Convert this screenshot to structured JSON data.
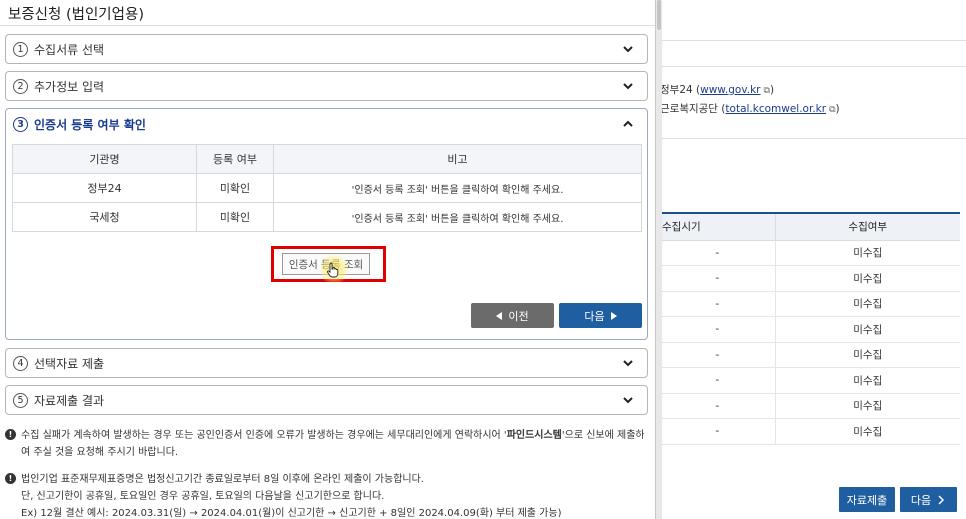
{
  "modal": {
    "title": "보증신청 (법인기업용)",
    "steps": [
      {
        "num": "1",
        "label": "수집서류 선택"
      },
      {
        "num": "2",
        "label": "추가정보 입력"
      },
      {
        "num": "3",
        "label": "인증서 등록 여부 확인"
      },
      {
        "num": "4",
        "label": "선택자료 제출"
      },
      {
        "num": "5",
        "label": "자료제출 결과"
      }
    ],
    "cert_table": {
      "headers": [
        "기관명",
        "등록 여부",
        "비고"
      ],
      "rows": [
        [
          "정부24",
          "미확인",
          "'인증서 등록 조회' 버튼을 클릭하여 확인해 주세요."
        ],
        [
          "국세청",
          "미확인",
          "'인증서 등록 조회' 버튼을 클릭하여 확인해 주세요."
        ]
      ]
    },
    "query_button": "인증서 등록 조회",
    "prev_button": "이전",
    "next_button": "다음",
    "notices": {
      "n1_pre": "수집 실패가 계속하여 발생하는 경우 또는 공인인증서 인증에 오류가 발생하는 경우에는 세무대리인에게 연락하시어 '",
      "n1_bold": "파인드시스템",
      "n1_post": "'으로 신보에 제출하여 주실 것을 요청해 주시기 바랍니다.",
      "n2_l1": "법인기업 표준재무제표증명은 법정신고기간 종료일로부터 8일 이후에 온라인 제출이 가능합니다.",
      "n2_l2": "단, 신고기한이 공휴일, 토요일인 경우 공휴일, 토요일의 다음날을 신고기한으로 합니다.",
      "n2_l3": "Ex) 12월 결산 예시: 2024.03.31(일) → 2024.04.01(월)이 신고기한 → 신고기한 + 8일인 2024.04.09(화) 부터 제출 가능)"
    }
  },
  "background": {
    "link1_prefix": "정부24 (",
    "link1_text": "www.gov.kr",
    "link1_suffix": ")",
    "link2_prefix": "근로복지공단 (",
    "link2_text": "total.kcomwel.or.kr",
    "link2_suffix": ")",
    "table_headers": [
      "수집시기",
      "수집여부"
    ],
    "table_rows": [
      [
        "-",
        "미수집"
      ],
      [
        "-",
        "미수집"
      ],
      [
        "-",
        "미수집"
      ],
      [
        "-",
        "미수집"
      ],
      [
        "-",
        "미수집"
      ],
      [
        "-",
        "미수집"
      ],
      [
        "-",
        "미수집"
      ],
      [
        "-",
        "미수집"
      ]
    ],
    "submit_button": "자료제출",
    "next_button": "다음"
  },
  "icons": {
    "chevron_down": "chevron-down-icon",
    "chevron_up": "chevron-up-icon",
    "external_link": "external-link-icon",
    "notice": "exclamation-icon",
    "cursor": "hand-pointer-icon"
  },
  "colors": {
    "primary": "#1f5ea0",
    "active_step": "#1a3c8f",
    "highlight": "#e00000",
    "prev_button": "#6b6b6b"
  }
}
